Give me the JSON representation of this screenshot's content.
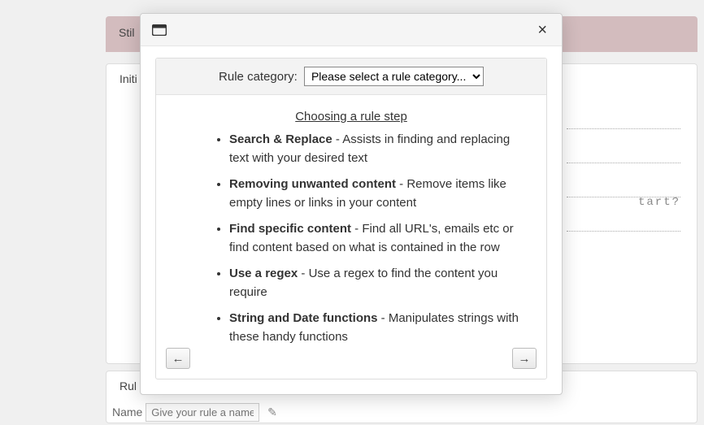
{
  "background": {
    "banner_text": "Stil",
    "panel1_text": "Initi",
    "panel2_text": "Rul",
    "tart_text": "tart?",
    "name_label": "Name",
    "name_placeholder": "Give your rule a name"
  },
  "modal": {
    "category_label": "Rule category:",
    "category_options": [
      "Please select a rule category..."
    ],
    "choosing_link": "Choosing a rule step",
    "items": [
      {
        "title": "Search & Replace",
        "desc": " - Assists in finding and replacing text with your desired text"
      },
      {
        "title": "Removing unwanted content",
        "desc": " - Remove items like empty lines or links in your content"
      },
      {
        "title": "Find specific content",
        "desc": " - Find all URL's, emails etc or find content based on what is contained in the row"
      },
      {
        "title": "Use a regex",
        "desc": " - Use a regex to find the content you require"
      },
      {
        "title": "String and Date functions",
        "desc": " - Manipulates strings with these handy functions"
      }
    ],
    "prev_glyph": "←",
    "next_glyph": "→",
    "close_glyph": "×"
  }
}
